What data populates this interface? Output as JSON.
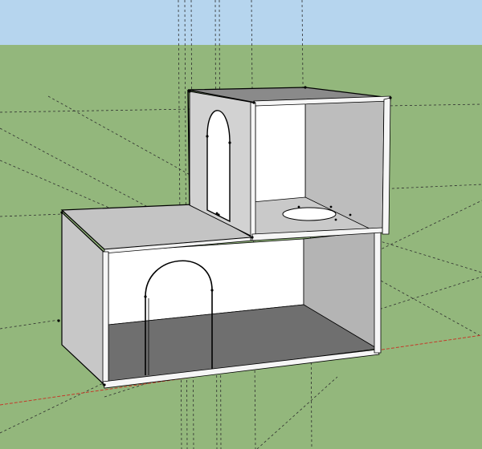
{
  "viewport": {
    "type": "3d-modeling-viewport",
    "colors": {
      "sky": "#b6d5ee",
      "ground": "#93b77c",
      "face_lit": "#ffffff",
      "face_shaded": "#c7c7c7",
      "face_mid": "#b4b4b4",
      "floor_shadow": "#6f6f6f",
      "edge": "#000000",
      "guide": "#333333",
      "axis_red": "#c43a2a"
    }
  },
  "model": {
    "name_icon": "two-storey-box-model-icon",
    "lower_box_openings": [
      "arched-doorway"
    ],
    "upper_box_openings": [
      "arched-doorway",
      "floor-hatch-ellipse"
    ],
    "inference_points": "endpoint-markers"
  }
}
